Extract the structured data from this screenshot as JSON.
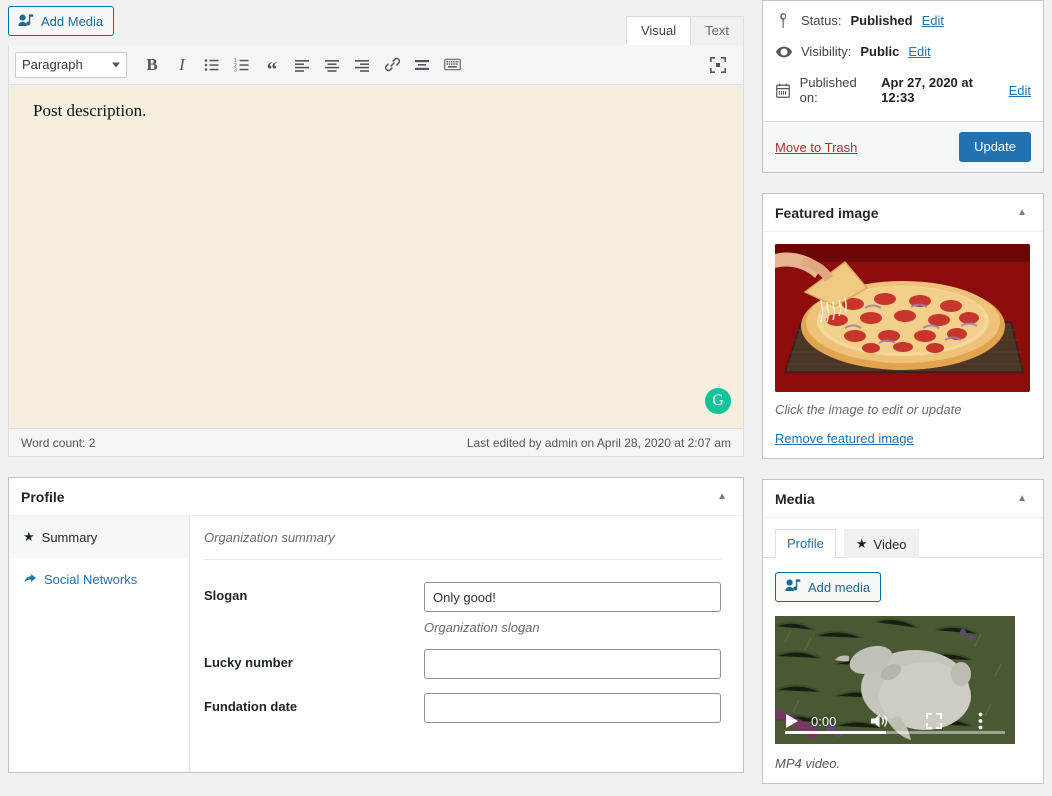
{
  "editor": {
    "add_media_label": "Add Media",
    "tabs": [
      {
        "label": "Visual",
        "active": true
      },
      {
        "label": "Text",
        "active": false
      }
    ],
    "format_select": "Paragraph",
    "toolbar_icons": [
      "bold-icon",
      "italic-icon",
      "bulleted-list-icon",
      "numbered-list-icon",
      "blockquote-icon",
      "align-left-icon",
      "align-center-icon",
      "align-right-icon",
      "link-icon",
      "insert-read-more-icon",
      "keyboard-shortcuts-icon"
    ],
    "fullscreen_icon": "distraction-free-icon",
    "content": "Post description.",
    "grammarly_badge": "G",
    "word_count": "Word count: 2",
    "last_edited": "Last edited by admin on April 28, 2020 at 2:07 am",
    "content_bg": "#f5efe0"
  },
  "profile": {
    "title": "Profile",
    "nav": [
      {
        "label": "Summary",
        "icon": "star-icon",
        "active": true
      },
      {
        "label": "Social Networks",
        "icon": "share-icon",
        "active": false
      }
    ],
    "section_title": "Organization summary",
    "fields": [
      {
        "label": "Slogan",
        "value": "Only good!",
        "help": "Organization slogan"
      },
      {
        "label": "Lucky number",
        "value": "",
        "help": ""
      },
      {
        "label": "Fundation date",
        "value": "",
        "help": ""
      }
    ]
  },
  "publish": {
    "status_label": "Status:",
    "status_value": "Published",
    "status_edit": "Edit",
    "visibility_label": "Visibility:",
    "visibility_value": "Public",
    "visibility_edit": "Edit",
    "published_label": "Published on:",
    "published_value": "Apr 27, 2020 at 12:33",
    "published_edit": "Edit",
    "trash_label": "Move to Trash",
    "update_label": "Update",
    "update_color": "#2271b1",
    "trash_color": "#b32d2e"
  },
  "featured_image": {
    "title": "Featured image",
    "image_alt": "pepperoni-pizza-on-wooden-board",
    "help": "Click the image to edit or update",
    "remove_label": "Remove featured image"
  },
  "media": {
    "title": "Media",
    "tabs": [
      {
        "label": "Profile",
        "active": false,
        "icon": ""
      },
      {
        "label": "Video",
        "active": true,
        "icon": "star-icon"
      }
    ],
    "add_media_label": "Add media",
    "video": {
      "time": "0:00",
      "alt": "white-goat-on-grass-video-thumbnail",
      "progress_percent": 46,
      "controls": [
        "play-icon",
        "volume-icon",
        "fullscreen-icon",
        "more-options-icon"
      ]
    },
    "caption": "MP4 video."
  }
}
